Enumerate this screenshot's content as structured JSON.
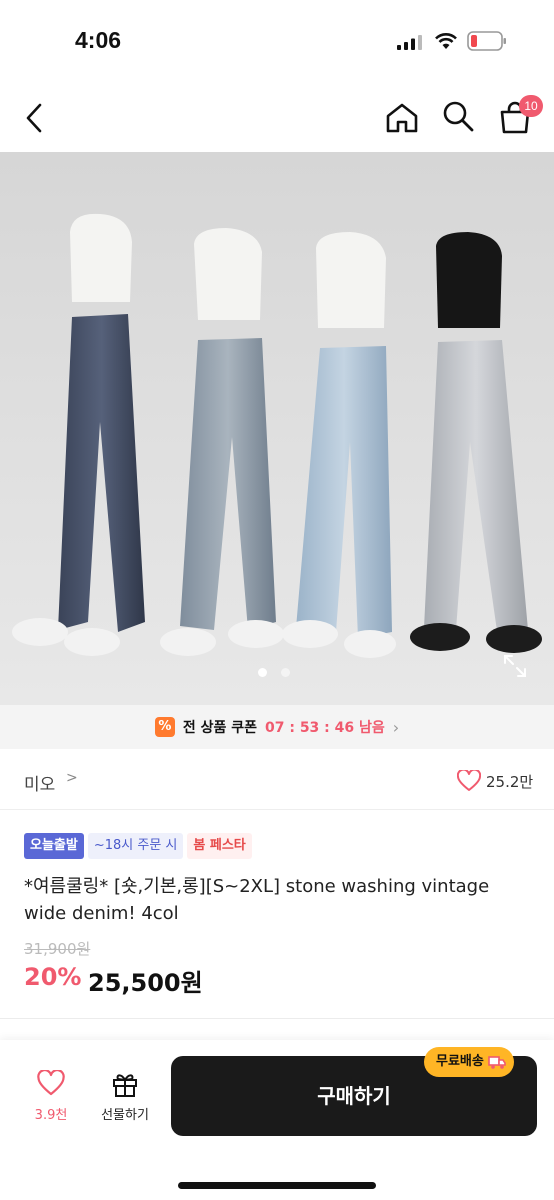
{
  "status": {
    "time": "4:06"
  },
  "header": {
    "cart_count": "10"
  },
  "coupon": {
    "label": "전 상품 쿠폰",
    "timer": "07 : 53 : 46",
    "suffix": "남음",
    "icon": "%"
  },
  "brand": {
    "name": "미오",
    "chevron": ">",
    "likes": "25.2만"
  },
  "badges": {
    "today": "오늘출발",
    "time": "~18시 주문 시",
    "fest": "봄 페스타"
  },
  "product": {
    "title": "*여름쿨링* [숏,기본,롱][S~2XL] stone washing vintage wide denim! 4col",
    "original_price": "31,900원",
    "discount_rate": "20%",
    "sale_price": "25,500원"
  },
  "bottom": {
    "like_count": "3.9천",
    "gift_label": "선물하기",
    "buy_label": "구매하기",
    "free_shipping": "무료배송"
  },
  "colors": {
    "accent": "#f05a6e",
    "badge_blue": "#5a68d6",
    "shipping": "#ffb525"
  },
  "icons": [
    "back-icon",
    "home-icon",
    "search-icon",
    "cart-icon",
    "expand-icon",
    "heart-icon",
    "gift-icon",
    "truck-icon"
  ]
}
